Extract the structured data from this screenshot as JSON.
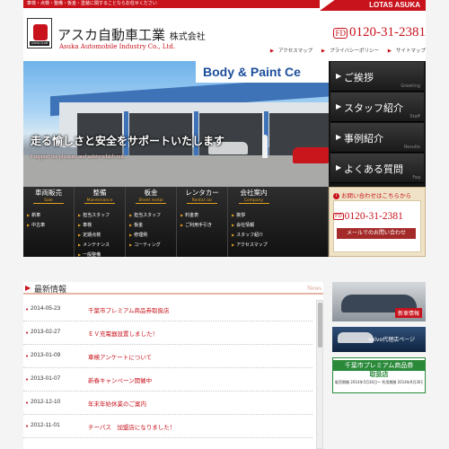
{
  "topbar": {
    "tagline": "車検・点検・整備・板金・塗装に関することならお任せください",
    "lotas_brand": "LOTAS ASUKA"
  },
  "header": {
    "logo_caption": "LOTAS CLUB",
    "company_jp": "アスカ自動車工業",
    "company_jp_suffix": "株式会社",
    "company_en": "Asuka Automobile Industry Co., Ltd.",
    "phone_badge": "FD",
    "phone": "0120-31-2381",
    "links": [
      "アクセスマップ",
      "プライバシーポリシー",
      "サイトマップ"
    ]
  },
  "hero": {
    "sign": "Body & Paint Ce",
    "headline": "走る愉しさと安全をサポートいたします",
    "subline": "I support the pleasure and safety which run."
  },
  "side_nav": [
    {
      "label": "ご挨拶",
      "en": "Greeting"
    },
    {
      "label": "スタッフ紹介",
      "en": "Staff"
    },
    {
      "label": "事例紹介",
      "en": "Results"
    },
    {
      "label": "よくある質問",
      "en": "Faq"
    }
  ],
  "menu": [
    {
      "label": "車両販売",
      "en": "Sale",
      "items": [
        "新車",
        "中古車"
      ]
    },
    {
      "label": "整備",
      "en": "Maintenance",
      "items": [
        "担当スタッフ",
        "車検",
        "定期点検",
        "メンテナンス",
        "一般整備"
      ]
    },
    {
      "label": "板金",
      "en": "Sheet metal",
      "items": [
        "担当スタッフ",
        "板金",
        "修理例",
        "コーティング"
      ]
    },
    {
      "label": "レンタカー",
      "en": "Rental car",
      "items": [
        "料金表",
        "ご利用手引き"
      ]
    },
    {
      "label": "会社案内",
      "en": "Company",
      "items": [
        "挨拶",
        "会社情報",
        "スタッフ紹介",
        "アクセスマップ"
      ]
    }
  ],
  "contact": {
    "title": "お問い合わせはこちらから",
    "phone_badge": "FD",
    "phone": "0120-31-2381",
    "mail_label": "メールでのお問い合わせ"
  },
  "news": {
    "title": "最新情報",
    "title_en": "News",
    "items": [
      {
        "date": "2014-05-23",
        "title": "千葉市プレミアム商品券取扱店"
      },
      {
        "date": "2013-02-27",
        "title": "ＥＶ充電器設置しました！"
      },
      {
        "date": "2013-01-09",
        "title": "車検アンケートについて"
      },
      {
        "date": "2013-01-07",
        "title": "新春キャンペーン開催中"
      },
      {
        "date": "2012-12-10",
        "title": "年末年始休業のご案内"
      },
      {
        "date": "2012-11-01",
        "title": "チーパス　加盟店になりました！"
      }
    ]
  },
  "banners": {
    "new_car": "新車情報",
    "volvo": "volvo代理店ページ",
    "premium_title": "千葉市プレミアム商品券",
    "premium_sub": "取扱店",
    "premium_note": "販売期間 2014年5月30日～ 利用期間 2014年9月30日まで"
  },
  "colors": {
    "brand_red": "#c8131c",
    "nav_dark": "#1a1a1a",
    "accent_gold": "#e0a020"
  }
}
